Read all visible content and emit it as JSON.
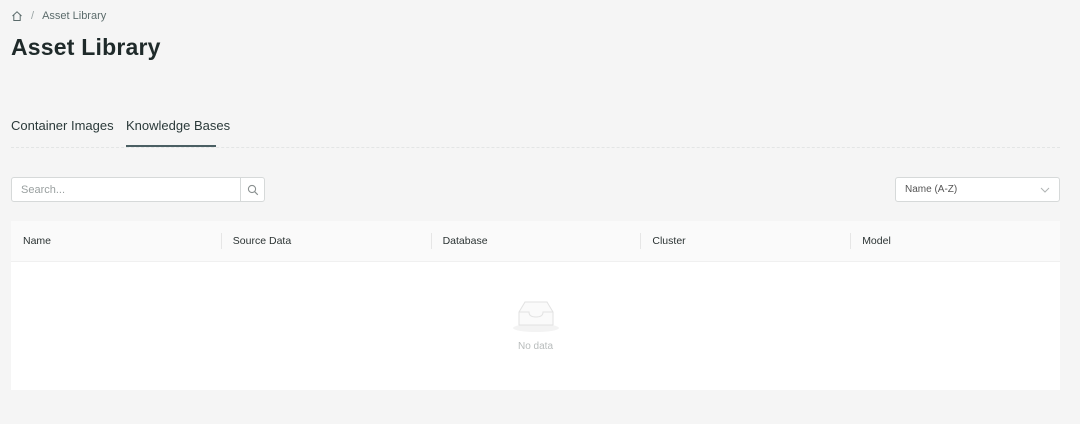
{
  "breadcrumb": {
    "current": "Asset Library",
    "separator": "/"
  },
  "page": {
    "title": "Asset Library"
  },
  "tabs": [
    {
      "label": "Container Images",
      "active": false
    },
    {
      "label": "Knowledge Bases",
      "active": true
    }
  ],
  "search": {
    "placeholder": "Search...",
    "value": ""
  },
  "sort": {
    "selected": "Name (A-Z)"
  },
  "table": {
    "columns": [
      "Name",
      "Source Data",
      "Database",
      "Cluster",
      "Model"
    ],
    "rows": [],
    "empty_text": "No data"
  },
  "icons": {
    "home": "home-icon",
    "search": "search-icon",
    "dropdown": "chevron-down-icon",
    "empty": "empty-inbox-icon"
  },
  "colors": {
    "background": "#f5f5f5",
    "active_tab_underline": "#4a5f63"
  }
}
